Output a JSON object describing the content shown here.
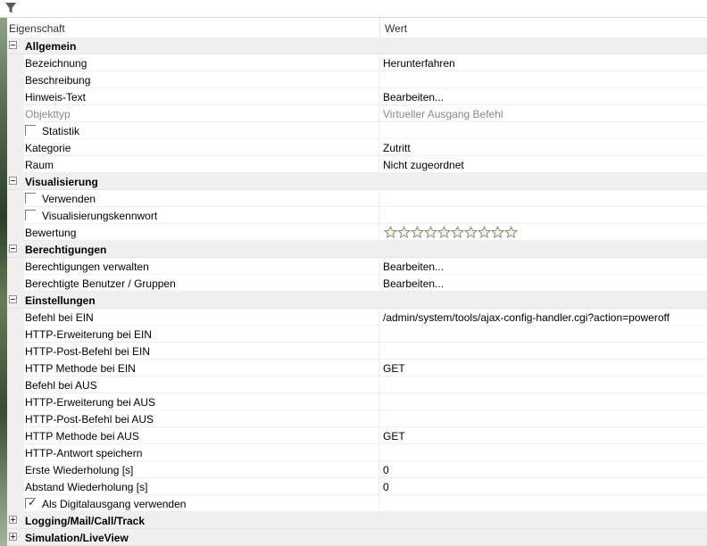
{
  "header": {
    "col_property": "Eigenschaft",
    "col_value": "Wert"
  },
  "rating": {
    "max_stars": 10,
    "filled": 0
  },
  "colors": {
    "category_bg": "#f0f0f0",
    "grid": "#eeeeee",
    "disabled_text": "#8a8a8a",
    "star_outline": "#8c8c72"
  },
  "rows": [
    {
      "type": "cat",
      "name": "Allgemein",
      "expanded": true
    },
    {
      "type": "prop",
      "name": "Bezeichnung",
      "value": "Herunterfahren"
    },
    {
      "type": "prop",
      "name": "Beschreibung",
      "value": ""
    },
    {
      "type": "prop",
      "name": "Hinweis-Text",
      "value": "Bearbeiten..."
    },
    {
      "type": "prop",
      "name": "Objekttyp",
      "value": "Virtueller Ausgang Befehl",
      "disabled": true
    },
    {
      "type": "check",
      "name": "Statistik",
      "checked": false,
      "value": ""
    },
    {
      "type": "prop",
      "name": "Kategorie",
      "value": "Zutritt"
    },
    {
      "type": "prop",
      "name": "Raum",
      "value": "Nicht zugeordnet"
    },
    {
      "type": "cat",
      "name": "Visualisierung",
      "expanded": true
    },
    {
      "type": "check",
      "name": "Verwenden",
      "checked": false,
      "value": ""
    },
    {
      "type": "check",
      "name": "Visualisierungskennwort",
      "checked": false,
      "value": ""
    },
    {
      "type": "stars",
      "name": "Bewertung"
    },
    {
      "type": "cat",
      "name": "Berechtigungen",
      "expanded": true
    },
    {
      "type": "prop",
      "name": "Berechtigungen verwalten",
      "value": "Bearbeiten..."
    },
    {
      "type": "prop",
      "name": "Berechtigte Benutzer / Gruppen",
      "value": "Bearbeiten..."
    },
    {
      "type": "cat",
      "name": "Einstellungen",
      "expanded": true
    },
    {
      "type": "prop",
      "name": "Befehl bei EIN",
      "value": "/admin/system/tools/ajax-config-handler.cgi?action=poweroff"
    },
    {
      "type": "prop",
      "name": "HTTP-Erweiterung bei EIN",
      "value": ""
    },
    {
      "type": "prop",
      "name": "HTTP-Post-Befehl bei EIN",
      "value": ""
    },
    {
      "type": "prop",
      "name": "HTTP Methode bei EIN",
      "value": "GET"
    },
    {
      "type": "prop",
      "name": "Befehl bei AUS",
      "value": ""
    },
    {
      "type": "prop",
      "name": "HTTP-Erweiterung bei AUS",
      "value": ""
    },
    {
      "type": "prop",
      "name": "HTTP-Post-Befehl bei AUS",
      "value": ""
    },
    {
      "type": "prop",
      "name": "HTTP Methode bei AUS",
      "value": "GET"
    },
    {
      "type": "prop",
      "name": "HTTP-Antwort speichern",
      "value": ""
    },
    {
      "type": "prop",
      "name": "Erste Wiederholung [s]",
      "value": "0"
    },
    {
      "type": "prop",
      "name": "Abstand Wiederholung [s]",
      "value": "0"
    },
    {
      "type": "check",
      "name": "Als Digitalausgang verwenden",
      "checked": true,
      "value": ""
    },
    {
      "type": "cat",
      "name": "Logging/Mail/Call/Track",
      "expanded": false
    },
    {
      "type": "cat",
      "name": "Simulation/LiveView",
      "expanded": false
    }
  ]
}
